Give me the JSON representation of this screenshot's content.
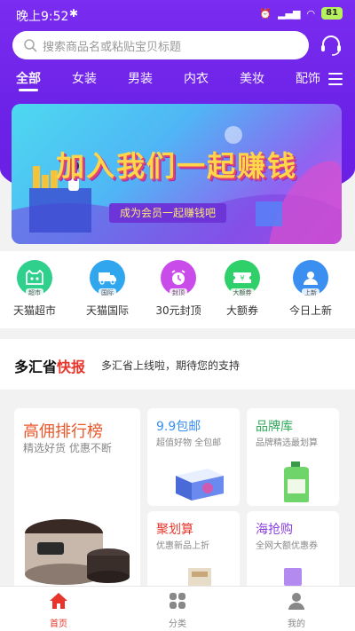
{
  "status_bar": {
    "time": "晚上9:52",
    "battery": "81"
  },
  "search": {
    "placeholder": "搜索商品名或粘贴宝贝标题"
  },
  "tabs": [
    "全部",
    "女装",
    "男装",
    "内衣",
    "美妆",
    "配饰"
  ],
  "active_tab": "全部",
  "banner": {
    "headline": "加入我们一起赚钱",
    "ribbon": "成为会员一起赚钱吧"
  },
  "quick_links": [
    {
      "label": "天猫超市",
      "badge": "超市",
      "icon": "tmall-cat-icon",
      "color": "#2fcf8c"
    },
    {
      "label": "天猫国际",
      "badge": "国际",
      "icon": "truck-icon",
      "color": "#2fa6ee"
    },
    {
      "label": "30元封顶",
      "badge": "封顶",
      "icon": "alarm-clock-icon",
      "color": "#c94bea"
    },
    {
      "label": "大额券",
      "badge": "大额券",
      "icon": "ticket-icon",
      "color": "#2fcf6a"
    },
    {
      "label": "今日上新",
      "badge": "上新",
      "icon": "new-user-icon",
      "color": "#3a8ff0"
    }
  ],
  "notice": {
    "brand_prefix": "多汇省",
    "brand_highlight": "快报",
    "message": "多汇省上线啦，期待您的支持"
  },
  "cards": {
    "big": {
      "title": "高佣排行榜",
      "subtitle": "精选好货  优惠不断"
    },
    "baoyou": {
      "title": "9.9包邮",
      "subtitle": "超值好物  全包邮",
      "color": "#3a8ff0"
    },
    "pinpai": {
      "title": "品牌库",
      "subtitle": "品牌精选最划算",
      "color": "#2faa5a"
    },
    "juhuasuan": {
      "title": "聚划算",
      "subtitle": "优惠新品上折",
      "color": "#e8342a"
    },
    "haiqiang": {
      "title": "海抢购",
      "subtitle": "全网大额优惠券",
      "color": "#8a3fe0"
    }
  },
  "bottom_nav": [
    {
      "label": "首页",
      "icon": "home-icon",
      "active": true
    },
    {
      "label": "分类",
      "icon": "category-icon",
      "active": false
    },
    {
      "label": "我的",
      "icon": "profile-icon",
      "active": false
    }
  ],
  "colors": {
    "brand_purple": "#6b22e6",
    "accent_red": "#e8342a"
  }
}
